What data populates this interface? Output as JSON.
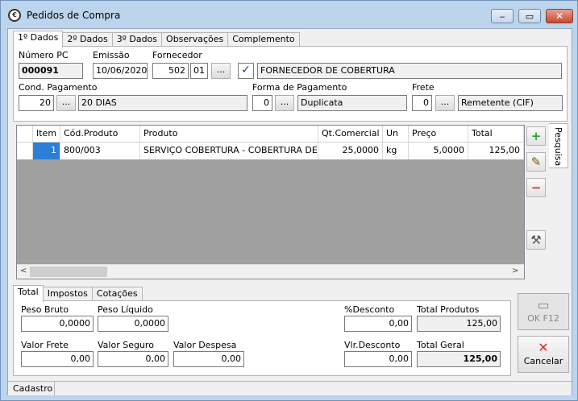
{
  "window": {
    "title": "Pedidos de Compra",
    "icon": "gear-cog-icon",
    "minimize": "‒",
    "maximize": "▭",
    "close": "✕"
  },
  "tabs": [
    "1º Dados",
    "2º Dados",
    "3º Dados",
    "Observações",
    "Complemento"
  ],
  "header": {
    "numero_pc_label": "Número PC",
    "numero_pc": "000091",
    "emissao_label": "Emissão",
    "emissao": "10/06/2020",
    "fornecedor_label": "Fornecedor",
    "fornecedor_code": "502",
    "fornecedor_loja": "01",
    "fornecedor_nome": "FORNECEDOR DE COBERTURA",
    "cond_label": "Cond. Pagamento",
    "cond_code": "20",
    "cond_desc": "20 DIAS",
    "forma_label": "Forma de Pagamento",
    "forma_code": "0",
    "forma_desc": "Duplicata",
    "frete_label": "Frete",
    "frete_code": "0",
    "frete_desc": "Remetente (CIF)",
    "dots": "..."
  },
  "grid": {
    "columns": [
      "",
      "Item",
      "Cód.Produto",
      "Produto",
      "Qt.Comercial",
      "Un",
      "Preço",
      "Total"
    ],
    "rows": [
      {
        "marker": "",
        "item": "1",
        "cod": "800/003",
        "produto": "SERVIÇO COBERTURA - COBERTURA DE ...",
        "qt": "25,0000",
        "un": "kg",
        "preco": "5,0000",
        "total": "125,00"
      }
    ]
  },
  "side_tab": "Pesquisa",
  "side_buttons": [
    {
      "name": "add-item-button",
      "icon": "plus-icon",
      "glyph": "+"
    },
    {
      "name": "edit-item-button",
      "icon": "edit-icon",
      "glyph": "✎"
    },
    {
      "name": "remove-item-button",
      "icon": "minus-icon",
      "glyph": "−"
    },
    {
      "name": "tools-button",
      "icon": "tools-icon",
      "glyph": "⚒"
    }
  ],
  "bottom_tabs": [
    "Total",
    "Impostos",
    "Cotações"
  ],
  "totals": {
    "peso_bruto_label": "Peso Bruto",
    "peso_bruto": "0,0000",
    "peso_liquido_label": "Peso Líquido",
    "peso_liquido": "0,0000",
    "desconto_pct_label": "%Desconto",
    "desconto_pct": "0,00",
    "total_produtos_label": "Total Produtos",
    "total_produtos": "125,00",
    "valor_frete_label": "Valor Frete",
    "valor_frete": "0,00",
    "valor_seguro_label": "Valor Seguro",
    "valor_seguro": "0,00",
    "valor_despesa_label": "Valor Despesa",
    "valor_despesa": "0,00",
    "vlr_desconto_label": "Vlr.Desconto",
    "vlr_desconto": "0,00",
    "total_geral_label": "Total Geral",
    "total_geral": "125,00"
  },
  "buttons": {
    "ok": "OK F12",
    "cancel": "Cancelar"
  },
  "status": "Cadastro",
  "colors": {
    "title_bg": "#bcd5ec",
    "selection": "#2b7fd9",
    "grid_empty": "#a0a0a0"
  }
}
